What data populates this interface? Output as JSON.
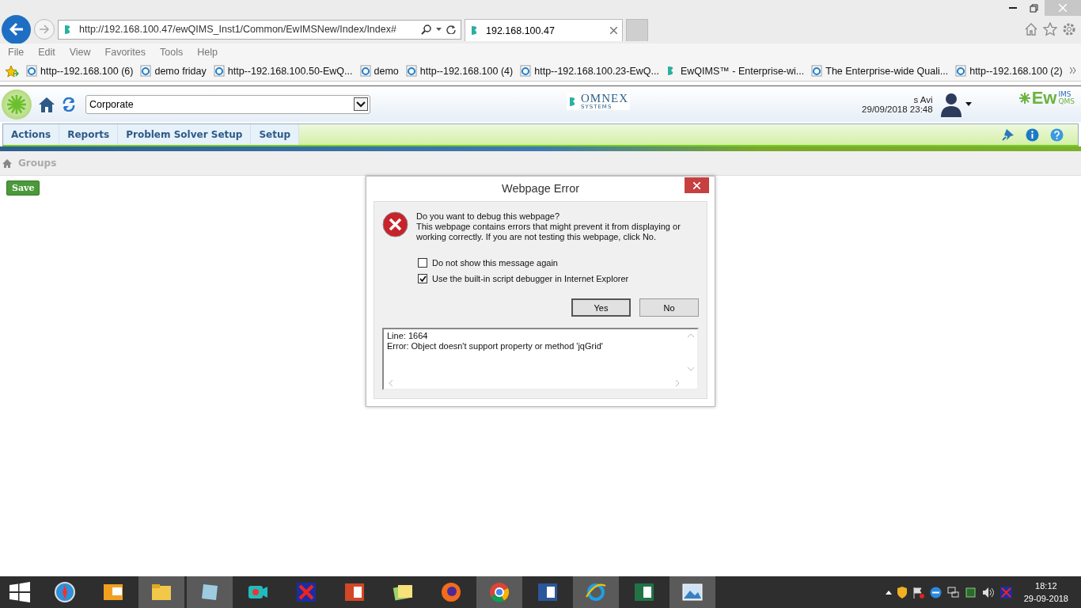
{
  "browser": {
    "url": "http://192.168.100.47/ewQIMS_Inst1/Common/EwIMSNew/Index/Index#",
    "tabs": [
      {
        "label": "192.168.100.47",
        "selected": true
      }
    ]
  },
  "menu": [
    "File",
    "Edit",
    "View",
    "Favorites",
    "Tools",
    "Help"
  ],
  "favorites": [
    {
      "label": "http--192.168.100 (6)",
      "kind": "ie"
    },
    {
      "label": "demo friday",
      "kind": "ie"
    },
    {
      "label": "http--192.168.100.50-EwQ...",
      "kind": "ie"
    },
    {
      "label": "demo",
      "kind": "ie"
    },
    {
      "label": "http--192.168.100 (4)",
      "kind": "ie"
    },
    {
      "label": "http--192.168.100.23-EwQ...",
      "kind": "ie"
    },
    {
      "label": "EwQIMS™ - Enterprise-wi...",
      "kind": "site"
    },
    {
      "label": "The Enterprise-wide Quali...",
      "kind": "ie"
    },
    {
      "label": "http--192.168.100 (2)",
      "kind": "ie"
    }
  ],
  "app_header": {
    "site": "Corporate",
    "logo_text": "OMNEX",
    "logo_subtext": "SYSTEMS",
    "user": "s Avi",
    "datetime": "29/09/2018 23:48",
    "brand": "Ew",
    "brand_super": "IMS",
    "brand_sub": "QMS"
  },
  "nav": [
    "Actions",
    "Reports",
    "Problem Solver Setup",
    "Setup"
  ],
  "breadcrumb": [
    "Groups"
  ],
  "save_button": "Save",
  "dialog": {
    "title": "Webpage Error",
    "heading": "Do you want to debug this webpage?",
    "message": "This webpage contains errors that might prevent it from displaying or working correctly. If you are not testing this webpage, click No.",
    "options": [
      {
        "label": "Do not show this message again",
        "checked": false
      },
      {
        "label": "Use the built-in script debugger in Internet Explorer",
        "checked": true
      }
    ],
    "buttons": [
      {
        "label": "Yes",
        "selected": true
      },
      {
        "label": "No",
        "selected": false
      }
    ],
    "details": [
      "Line: 1664",
      "Error: Object doesn't support property or method 'jqGrid'"
    ]
  },
  "taskbar": {
    "apps": [
      {
        "kind": "compass",
        "active": false
      },
      {
        "kind": "mail",
        "active": false
      },
      {
        "kind": "folder",
        "active": true
      },
      {
        "kind": "notepad",
        "active": true
      },
      {
        "kind": "camera",
        "active": false
      },
      {
        "kind": "redapp",
        "active": false
      },
      {
        "kind": "slides",
        "active": false
      },
      {
        "kind": "notes",
        "active": false
      },
      {
        "kind": "firefox",
        "active": false
      },
      {
        "kind": "chrome",
        "active": true
      },
      {
        "kind": "word",
        "active": false
      },
      {
        "kind": "ie",
        "active": true
      },
      {
        "kind": "excel",
        "active": false
      },
      {
        "kind": "photo",
        "active": true
      }
    ],
    "time": "18:12",
    "date": "29-09-2018"
  }
}
